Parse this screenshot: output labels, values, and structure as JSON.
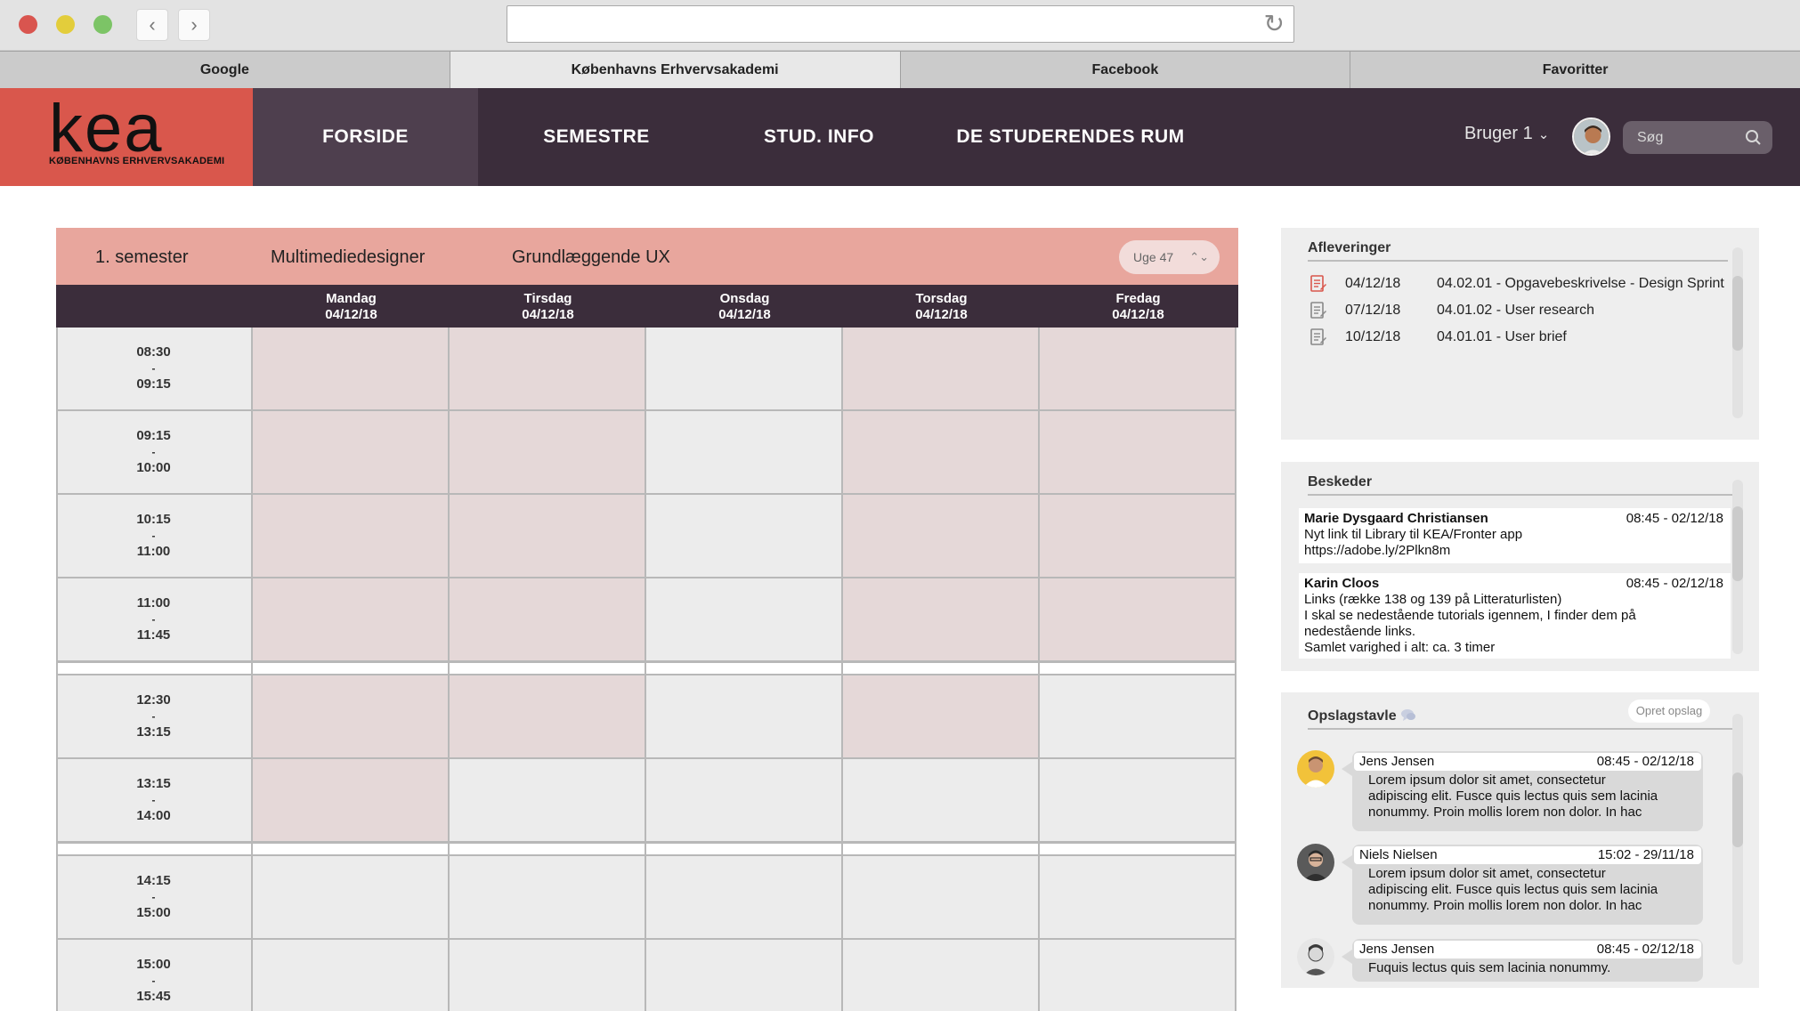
{
  "browser": {
    "tabs": [
      {
        "label": "Google",
        "active": false
      },
      {
        "label": "Københavns Erhvervsakademi",
        "active": true
      },
      {
        "label": "Facebook",
        "active": false
      },
      {
        "label": "Favoritter",
        "active": false
      }
    ],
    "url": ""
  },
  "header": {
    "logo_text": "kea",
    "logo_subtitle": "KØBENHAVNS ERHVERVSAKADEMI",
    "nav": [
      "FORSIDE",
      "SEMESTRE",
      "STUD. INFO",
      "DE STUDERENDES RUM"
    ],
    "active_nav": "FORSIDE",
    "user_label": "Bruger 1",
    "search_placeholder": "Søg",
    "colors": {
      "header_bg": "#3b2d3b",
      "logo_bg": "#d9574c",
      "active_nav_bg": "#4e3f4e"
    }
  },
  "schedule": {
    "semester": "1. semester",
    "education": "Multimediedesigner",
    "course": "Grundlæggende UX",
    "week": "Uge 47",
    "days": [
      {
        "name": "Mandag",
        "date": "04/12/18"
      },
      {
        "name": "Tirsdag",
        "date": "04/12/18"
      },
      {
        "name": "Onsdag",
        "date": "04/12/18"
      },
      {
        "name": "Torsdag",
        "date": "04/12/18"
      },
      {
        "name": "Fredag",
        "date": "04/12/18"
      }
    ],
    "slots": [
      {
        "start": "08:30",
        "end": "09:15",
        "booked": [
          true,
          true,
          false,
          true,
          true
        ]
      },
      {
        "start": "09:15",
        "end": "10:00",
        "booked": [
          true,
          true,
          false,
          true,
          true
        ]
      },
      {
        "start": "10:15",
        "end": "11:00",
        "booked": [
          true,
          true,
          false,
          true,
          true
        ]
      },
      {
        "start": "11:00",
        "end": "11:45",
        "booked": [
          true,
          true,
          false,
          true,
          true
        ]
      },
      {
        "start": "12:30",
        "end": "13:15",
        "booked": [
          true,
          true,
          false,
          true,
          false
        ]
      },
      {
        "start": "13:15",
        "end": "14:00",
        "booked": [
          true,
          false,
          false,
          false,
          false
        ]
      },
      {
        "start": "14:15",
        "end": "15:00",
        "booked": [
          false,
          false,
          false,
          false,
          false
        ]
      },
      {
        "start": "15:00",
        "end": "15:45",
        "booked": [
          false,
          false,
          false,
          false,
          false
        ]
      }
    ],
    "colors": {
      "booked": "#e5d8d8",
      "free": "#ececec",
      "header": "#e8a69d"
    }
  },
  "deliveries": {
    "title": "Afleveringer",
    "items": [
      {
        "date": "04/12/18",
        "title": "04.02.01 - Opgavebeskrivelse - Design Sprint",
        "icon": "document-red-icon"
      },
      {
        "date": "07/12/18",
        "title": "04.01.02 - User research",
        "icon": "document-icon"
      },
      {
        "date": "10/12/18",
        "title": "04.01.01 - User brief",
        "icon": "document-icon"
      }
    ]
  },
  "messages": {
    "title": "Beskeder",
    "items": [
      {
        "from": "Marie Dysgaard Christiansen",
        "time": "08:45 - 02/12/18",
        "lines": [
          "Nyt link til Library til KEA/Fronter app",
          "https://adobe.ly/2Plkn8m"
        ]
      },
      {
        "from": "Karin Cloos",
        "time": "08:45 - 02/12/18",
        "lines": [
          "Links (række 138 og 139 på Litteraturlisten)",
          "I skal se nedestående tutorials igennem, I finder dem på",
          "nedestående links.",
          "Samlet varighed i alt: ca. 3 timer"
        ]
      }
    ]
  },
  "board": {
    "title": "Opslagstavle",
    "create_label": "Opret opslag",
    "posts": [
      {
        "author": "Jens Jensen",
        "time": "08:45 - 02/12/18",
        "lines": [
          "Lorem ipsum dolor sit amet, consectetur",
          "adipiscing elit. Fusce quis lectus quis sem lacinia",
          "nonummy. Proin mollis lorem non dolor. In hac"
        ],
        "avatar_color": "#f2c23a"
      },
      {
        "author": "Niels Nielsen",
        "time": "15:02 - 29/11/18",
        "lines": [
          "Lorem ipsum dolor sit amet, consectetur",
          "adipiscing elit. Fusce quis lectus quis sem lacinia",
          "nonummy. Proin mollis lorem non dolor. In hac"
        ],
        "avatar_color": "#5a5a5a"
      },
      {
        "author": "Jens Jensen",
        "time": "08:45 - 02/12/18",
        "lines": [
          "Fuquis lectus quis sem lacinia nonummy."
        ],
        "avatar_color": "#e6e6e6"
      }
    ]
  }
}
